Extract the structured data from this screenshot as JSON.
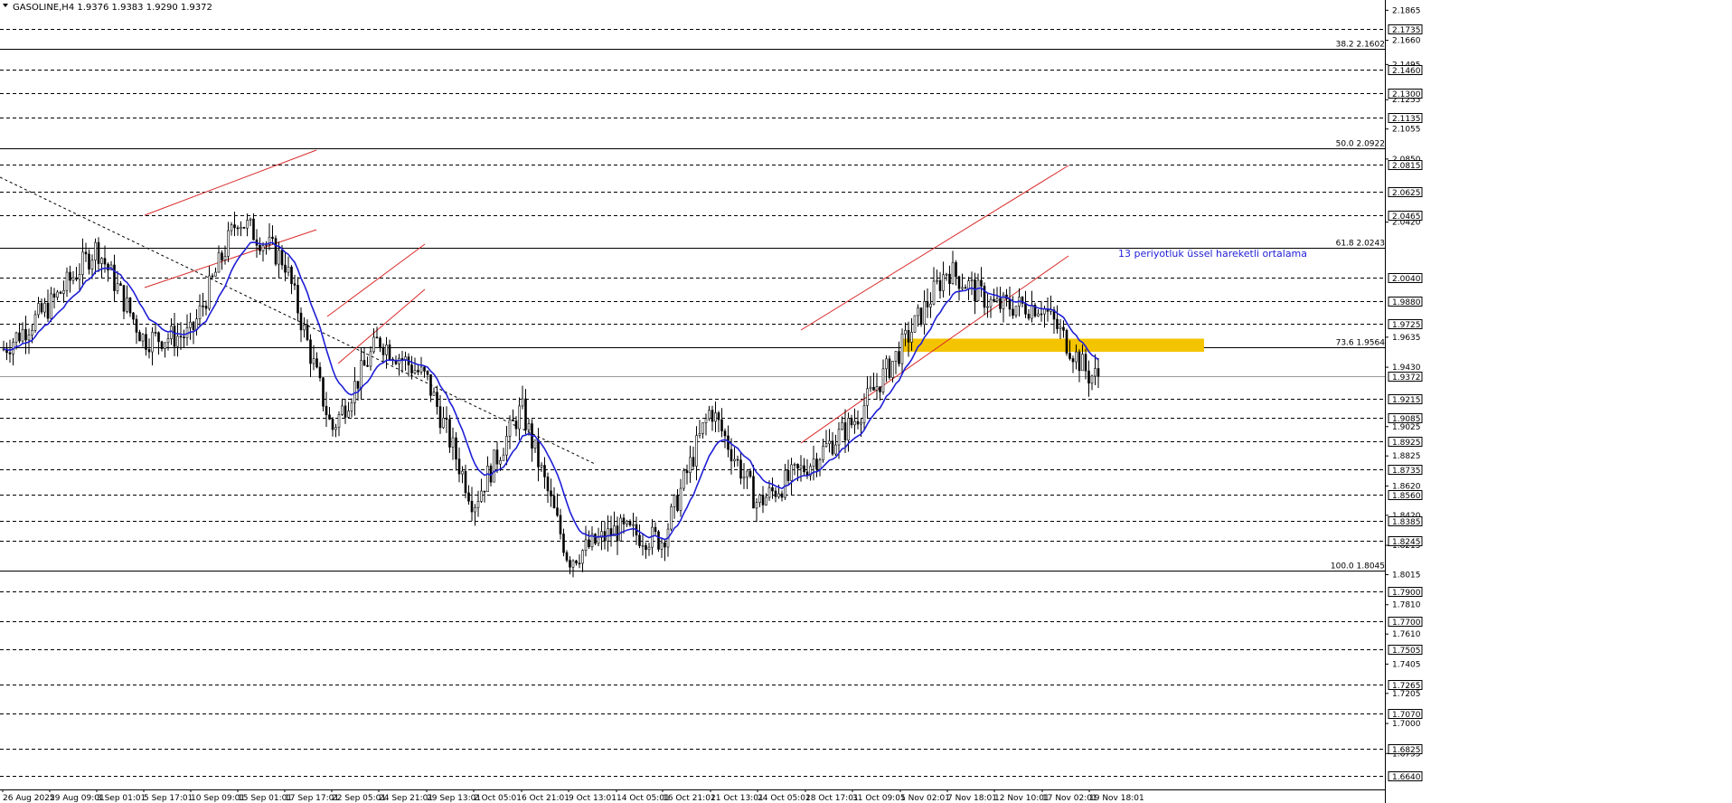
{
  "header": {
    "symbol_line": "GASOLINE,H4  1.9376 1.9383 1.9290 1.9372"
  },
  "annotation": "13 periyotluk üssel hareketli ortalama",
  "colors": {
    "candle": "#000000",
    "ema": "#1f1fd6",
    "channel": "#d92a2a",
    "zone": "#f5c400",
    "grid": "#000000"
  },
  "price_axis": {
    "plain_ticks": [
      "2.1865",
      "2.1660",
      "2.1495",
      "2.1255",
      "2.1055",
      "2.0850",
      "2.0420",
      "1.9635",
      "1.9430",
      "1.9025",
      "1.8825",
      "1.8620",
      "1.8420",
      "1.8215",
      "1.8015",
      "1.7810",
      "1.7610",
      "1.7405",
      "1.7205",
      "1.7000",
      "1.6795"
    ],
    "boxed_levels": [
      "2.1735",
      "2.1460",
      "2.1300",
      "2.1135",
      "2.0815",
      "2.0625",
      "2.0465",
      "2.0040",
      "1.9880",
      "1.9725",
      "1.9372",
      "1.9215",
      "1.9085",
      "1.8925",
      "1.8735",
      "1.8560",
      "1.8385",
      "1.8245",
      "1.7900",
      "1.7700",
      "1.7505",
      "1.7265",
      "1.7070",
      "1.6825",
      "1.6640"
    ]
  },
  "fib_levels": [
    {
      "label": "38.2 2.1602",
      "price": 2.1602
    },
    {
      "label": "50.0 2.0922",
      "price": 2.0922
    },
    {
      "label": "61.8 2.0243",
      "price": 2.0243
    },
    {
      "label": "73.6 1.9564",
      "price": 1.9564
    },
    {
      "label": "100.0 1.8045",
      "price": 1.8045
    }
  ],
  "time_axis": [
    "26 Aug 2025",
    "29 Aug 09:01",
    "3 Sep 01:01",
    "5 Sep 17:01",
    "10 Sep 09:01",
    "15 Sep 01:01",
    "17 Sep 17:01",
    "22 Sep 05:01",
    "24 Sep 21:01",
    "29 Sep 13:01",
    "2 Oct 05:01",
    "6 Oct 21:01",
    "9 Oct 13:01",
    "14 Oct 05:01",
    "16 Oct 21:01",
    "21 Oct 13:01",
    "24 Oct 05:01",
    "28 Oct 17:01",
    "31 Oct 09:01",
    "5 Nov 02:01",
    "7 Nov 18:01",
    "12 Nov 10:01",
    "17 Nov 02:01",
    "19 Nov 18:01"
  ],
  "chart_data": {
    "type": "candlestick",
    "title": "GASOLINE,H4",
    "last_price": 1.9372,
    "ylim": [
      1.655,
      2.1935
    ],
    "path_anchors": [
      {
        "t": "26 Aug 2025",
        "price": 1.955
      },
      {
        "t": "29 Aug 09:01",
        "price": 1.985
      },
      {
        "t": "3 Sep 01:01",
        "price": 2.025
      },
      {
        "t": "5 Sep 17:01",
        "price": 1.962
      },
      {
        "t": "10 Sep 09:01",
        "price": 1.965
      },
      {
        "t": "15 Sep 01:01",
        "price": 2.045
      },
      {
        "t": "17 Sep 17:01",
        "price": 2.015
      },
      {
        "t": "22 Sep 05:01",
        "price": 1.9
      },
      {
        "t": "24 Sep 21:01",
        "price": 1.962
      },
      {
        "t": "29 Sep 13:01",
        "price": 1.935
      },
      {
        "t": "2 Oct 05:01",
        "price": 1.85
      },
      {
        "t": "6 Oct 21:01",
        "price": 1.915
      },
      {
        "t": "9 Oct 13:01",
        "price": 1.812
      },
      {
        "t": "14 Oct 05:01",
        "price": 1.832
      },
      {
        "t": "16 Oct 21:01",
        "price": 1.825
      },
      {
        "t": "21 Oct 13:01",
        "price": 1.915
      },
      {
        "t": "24 Oct 05:01",
        "price": 1.85
      },
      {
        "t": "28 Oct 17:01",
        "price": 1.875
      },
      {
        "t": "31 Oct 09:01",
        "price": 1.905
      },
      {
        "t": "5 Nov 02:01",
        "price": 1.955
      },
      {
        "t": "7 Nov 18:01",
        "price": 2.01
      },
      {
        "t": "12 Nov 10:01",
        "price": 1.985
      },
      {
        "t": "17 Nov 02:01",
        "price": 1.985
      },
      {
        "t": "19 Nov 18:01",
        "price": 1.9372
      }
    ],
    "ema_period": 13,
    "zone": {
      "from": 1.9535,
      "to": 1.9625
    }
  }
}
